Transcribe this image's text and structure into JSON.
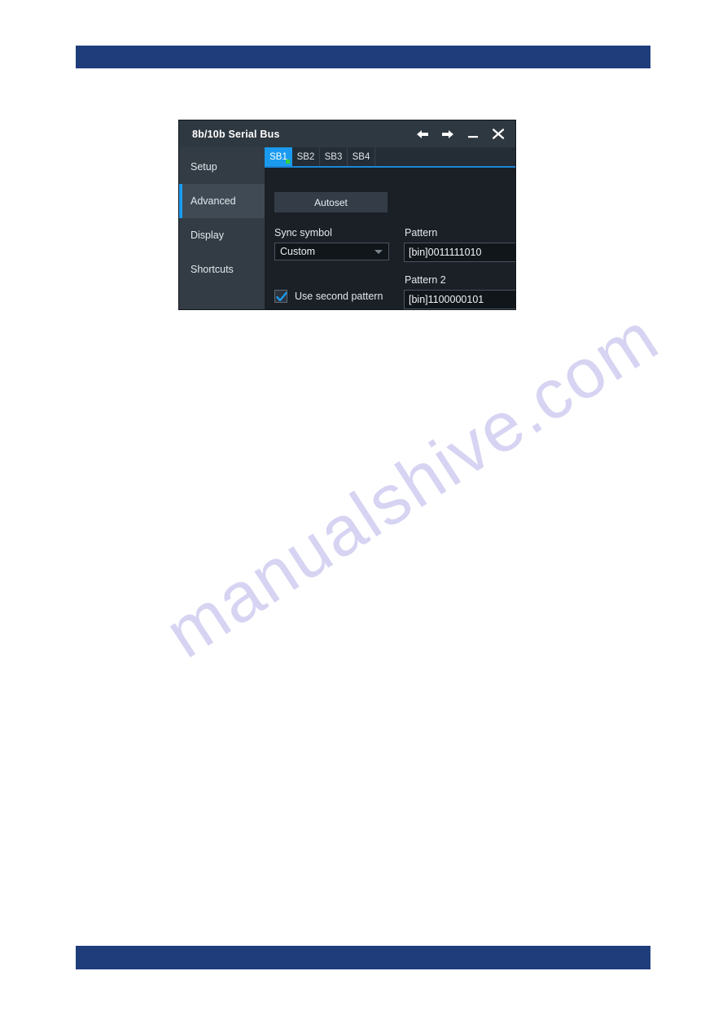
{
  "page": {
    "watermark": "manualshive.com",
    "top_bar_color": "#1f3d7a",
    "bottom_bar_color": "#1f3d7a"
  },
  "dialog": {
    "title": "8b/10b Serial Bus",
    "accent_color": "#1b9bef",
    "titlebar_color": "#2e3840",
    "controls": [
      {
        "name": "back-icon",
        "label": "Back"
      },
      {
        "name": "forward-icon",
        "label": "Forward"
      },
      {
        "name": "minimize-icon",
        "label": "Minimize"
      },
      {
        "name": "close-icon",
        "label": "Close"
      }
    ],
    "sidebar": {
      "items": [
        {
          "label": "Setup",
          "active": false
        },
        {
          "label": "Advanced",
          "active": true
        },
        {
          "label": "Display",
          "active": false
        },
        {
          "label": "Shortcuts",
          "active": false
        }
      ]
    },
    "tabs": [
      {
        "label": "SB1",
        "active": true,
        "indicator_color": "#37d23a"
      },
      {
        "label": "SB2",
        "active": false
      },
      {
        "label": "SB3",
        "active": false
      },
      {
        "label": "SB4",
        "active": false
      }
    ],
    "form": {
      "autoset_label": "Autoset",
      "sync_symbol_label": "Sync symbol",
      "sync_symbol_value": "Custom",
      "pattern_label": "Pattern",
      "pattern_value": "[bin]0011111010",
      "pattern2_label": "Pattern 2",
      "pattern2_value": "[bin]1100000101",
      "use_second_pattern_label": "Use second pattern",
      "use_second_pattern_checked": true
    }
  }
}
